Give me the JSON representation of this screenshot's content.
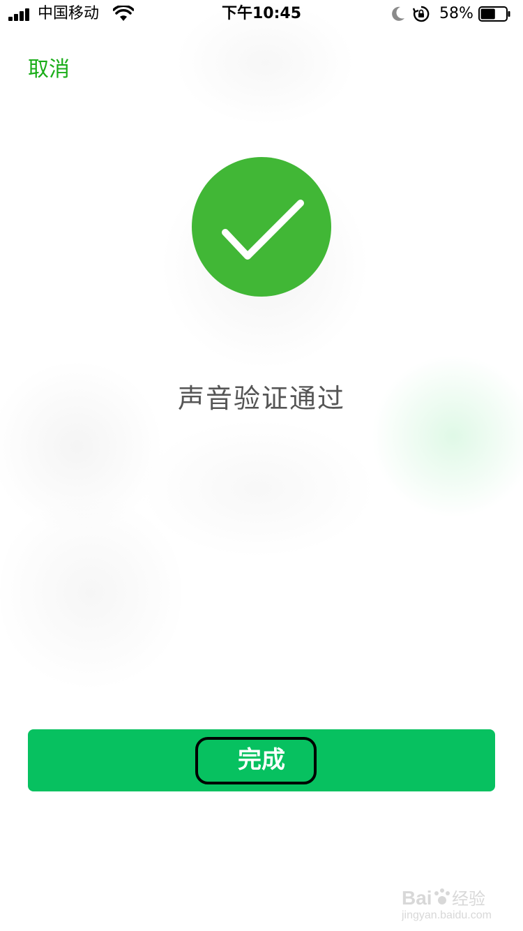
{
  "status_bar": {
    "carrier": "中国移动",
    "time": "下午10:45",
    "battery_percent": "58%",
    "battery_level": 0.58
  },
  "header": {
    "cancel_label": "取消"
  },
  "main": {
    "message": "声音验证通过"
  },
  "footer": {
    "done_label": "完成"
  },
  "watermark": {
    "brand_text": "Bai du 经验",
    "url": "jingyan.baidu.com"
  },
  "colors": {
    "accent_green": "#1aad19",
    "success_circle": "#41b736",
    "button_green": "#07c160"
  }
}
